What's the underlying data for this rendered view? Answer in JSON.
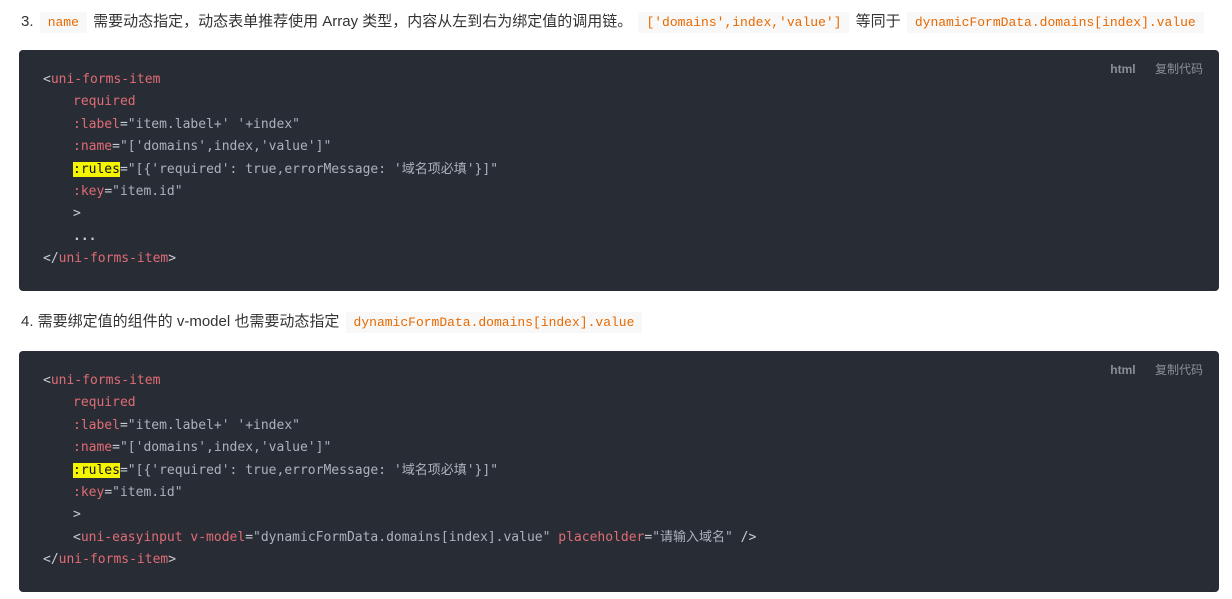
{
  "step3": {
    "number": "3.",
    "code_name": "name",
    "text_a": "需要动态指定，动态表单推荐使用 Array 类型，内容从左到右为绑定值的调用链。",
    "code_chain": "['domains',index,'value']",
    "text_b": "等同于",
    "code_path": "dynamicFormData.domains[index].value"
  },
  "step4": {
    "text": "4. 需要绑定值的组件的 v-model 也需要动态指定",
    "code_path": "dynamicFormData.domains[index].value"
  },
  "code_block_1": {
    "lang": "html",
    "copy_label": "复制代码",
    "open_tag": "uni-forms-item",
    "required": "required",
    "label_attr": ":label",
    "label_val": "\"item.label+' '+index\"",
    "name_attr": ":name",
    "name_val": "\"['domains',index,'value']\"",
    "rules_attr": ":rules",
    "rules_val": "\"[{'required': true,errorMessage: '域名项必填'}]\"",
    "key_attr": ":key",
    "key_val": "\"item.id\"",
    "gt": ">",
    "ellipsis": "...",
    "close_tag": "uni-forms-item"
  },
  "code_block_2": {
    "lang": "html",
    "copy_label": "复制代码",
    "open_tag": "uni-forms-item",
    "required": "required",
    "label_attr": ":label",
    "label_val": "\"item.label+' '+index\"",
    "name_attr": ":name",
    "name_val": "\"['domains',index,'value']\"",
    "rules_attr": ":rules",
    "rules_val": "\"[{'required': true,errorMessage: '域名项必填'}]\"",
    "key_attr": ":key",
    "key_val": "\"item.id\"",
    "gt": ">",
    "child_tag": "uni-easyinput",
    "vmodel_attr": "v-model",
    "vmodel_val": "\"dynamicFormData.domains[index].value\"",
    "placeholder_attr": "placeholder",
    "placeholder_val": "\"请输入域名\"",
    "self_close": " />",
    "close_tag": "uni-forms-item"
  }
}
